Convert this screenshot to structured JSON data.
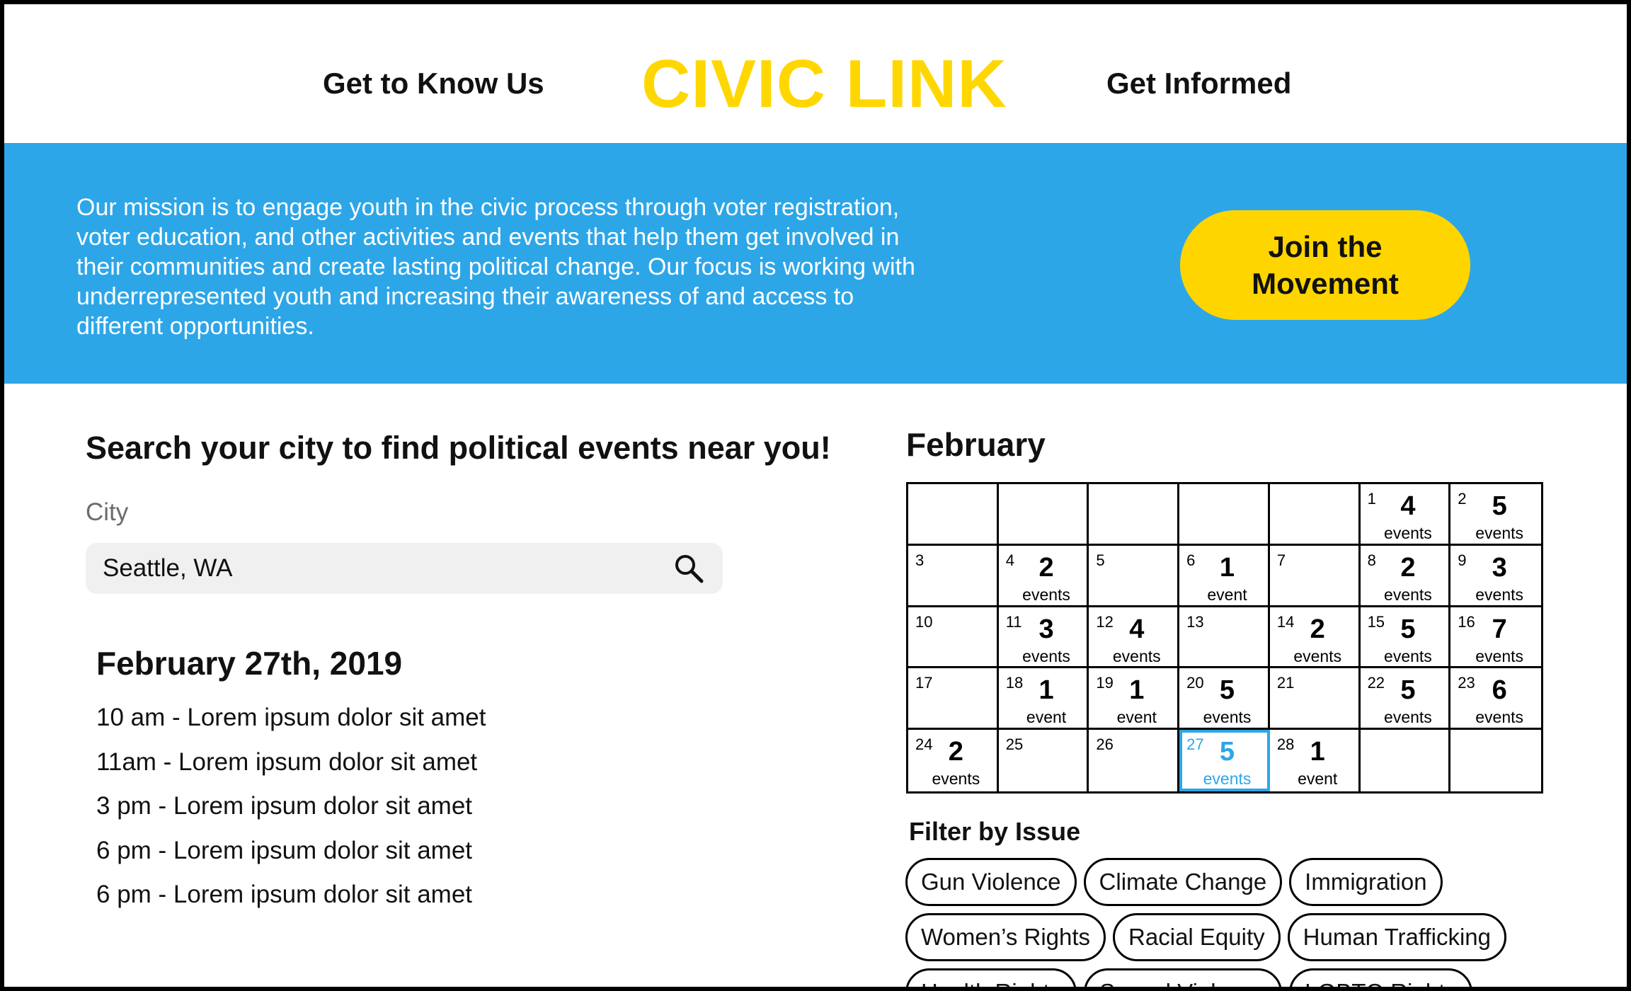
{
  "header": {
    "nav_left": "Get to Know Us",
    "logo": "CIVIC LINK",
    "nav_right": "Get Informed"
  },
  "banner": {
    "mission": "Our  mission is to engage youth in the civic process through voter registration,\nvoter education, and other activities and events that help them get involved in\ntheir communities and create lasting political change. Our focus is working with\nunderrepresented youth and increasing their awareness of and access to\ndifferent opportunities.",
    "join_button": "Join the\nMovement"
  },
  "search": {
    "heading": "Search your city to find political events near you!",
    "city_label": "City",
    "city_value": "Seattle, WA",
    "icon": "search-icon"
  },
  "events": {
    "date": "February 27th, 2019",
    "items": [
      "10 am - Lorem ipsum dolor sit amet",
      "11am - Lorem ipsum dolor sit amet",
      "3 pm - Lorem ipsum dolor sit amet",
      "6 pm - Lorem ipsum dolor sit amet",
      "6 pm - Lorem ipsum dolor sit amet"
    ]
  },
  "calendar": {
    "month": "February",
    "selected_day": "27",
    "cells": [
      {
        "day": "",
        "count": "",
        "label": ""
      },
      {
        "day": "",
        "count": "",
        "label": ""
      },
      {
        "day": "",
        "count": "",
        "label": ""
      },
      {
        "day": "",
        "count": "",
        "label": ""
      },
      {
        "day": "",
        "count": "",
        "label": ""
      },
      {
        "day": "1",
        "count": "4",
        "label": "events"
      },
      {
        "day": "2",
        "count": "5",
        "label": "events"
      },
      {
        "day": "3",
        "count": "",
        "label": ""
      },
      {
        "day": "4",
        "count": "2",
        "label": "events"
      },
      {
        "day": "5",
        "count": "",
        "label": ""
      },
      {
        "day": "6",
        "count": "1",
        "label": "event"
      },
      {
        "day": "7",
        "count": "",
        "label": ""
      },
      {
        "day": "8",
        "count": "2",
        "label": "events"
      },
      {
        "day": "9",
        "count": "3",
        "label": "events"
      },
      {
        "day": "10",
        "count": "",
        "label": ""
      },
      {
        "day": "11",
        "count": "3",
        "label": "events"
      },
      {
        "day": "12",
        "count": "4",
        "label": "events"
      },
      {
        "day": "13",
        "count": "",
        "label": ""
      },
      {
        "day": "14",
        "count": "2",
        "label": "events"
      },
      {
        "day": "15",
        "count": "5",
        "label": "events"
      },
      {
        "day": "16",
        "count": "7",
        "label": "events"
      },
      {
        "day": "17",
        "count": "",
        "label": ""
      },
      {
        "day": "18",
        "count": "1",
        "label": "event"
      },
      {
        "day": "19",
        "count": "1",
        "label": "event"
      },
      {
        "day": "20",
        "count": "5",
        "label": "events"
      },
      {
        "day": "21",
        "count": "",
        "label": ""
      },
      {
        "day": "22",
        "count": "5",
        "label": "events"
      },
      {
        "day": "23",
        "count": "6",
        "label": "events"
      },
      {
        "day": "24",
        "count": "2",
        "label": "events"
      },
      {
        "day": "25",
        "count": "",
        "label": ""
      },
      {
        "day": "26",
        "count": "",
        "label": ""
      },
      {
        "day": "27",
        "count": "5",
        "label": "events"
      },
      {
        "day": "28",
        "count": "1",
        "label": "event"
      },
      {
        "day": "",
        "count": "",
        "label": ""
      },
      {
        "day": "",
        "count": "",
        "label": ""
      }
    ]
  },
  "filters": {
    "heading": "Filter by Issue",
    "items": [
      "Gun Violence",
      "Climate Change",
      "Immigration",
      "Women’s Rights",
      "Racial Equity",
      "Human Trafficking",
      "Health Rights",
      "Sexual Violence",
      "LGBTQ Rights"
    ]
  },
  "colors": {
    "brand_yellow": "#FFD700",
    "banner_blue": "#2DA6E8",
    "selected_blue": "#2DA6E8"
  }
}
